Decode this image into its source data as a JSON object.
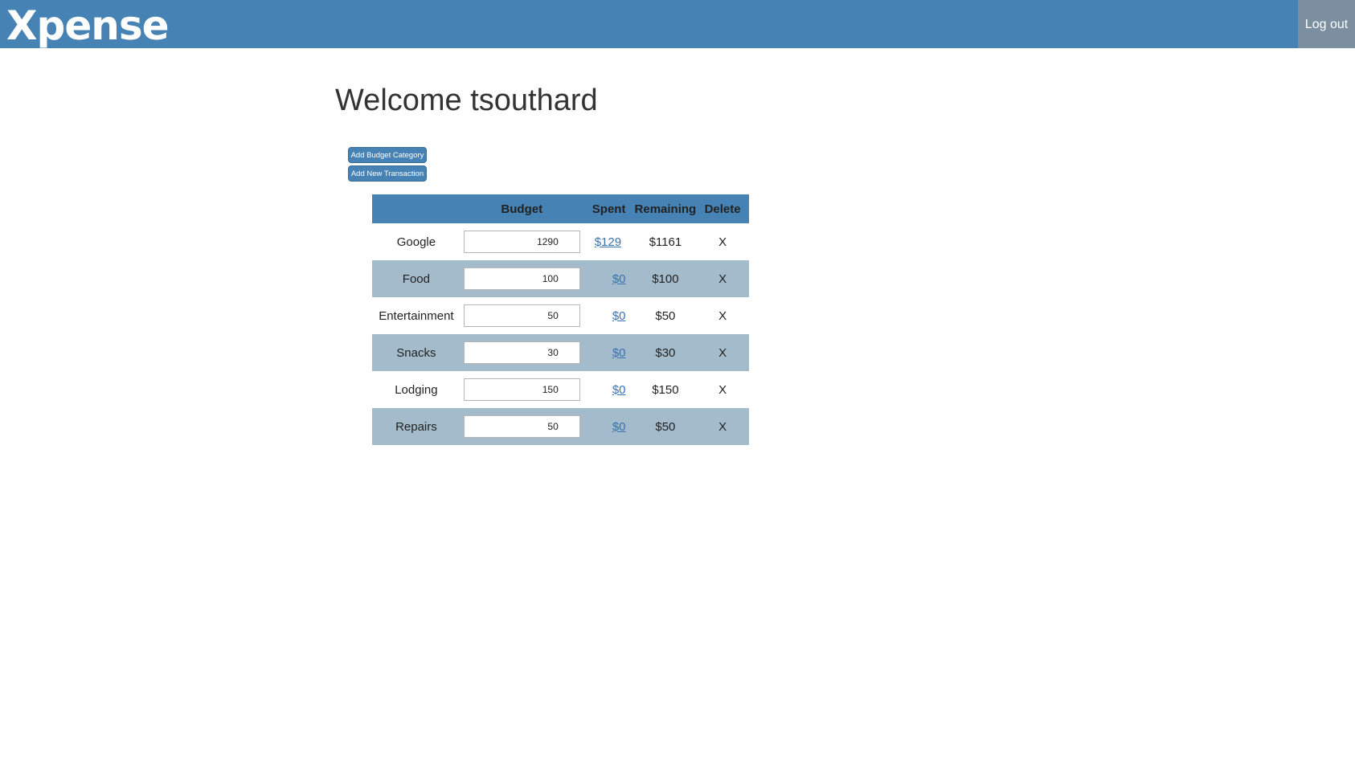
{
  "header": {
    "logo": "Xpense",
    "logout_label": "Log out"
  },
  "main": {
    "welcome": "Welcome tsouthard",
    "add_category_label": "Add Budget Category",
    "add_transaction_label": "Add New Transaction"
  },
  "table": {
    "headers": [
      "",
      "Budget",
      "Spent",
      "Remaining",
      "Delete"
    ],
    "rows": [
      {
        "name": "Google",
        "budget": "1290",
        "spent": "$129",
        "remaining": "$1161",
        "delete": "X"
      },
      {
        "name": "Food",
        "budget": "100",
        "spent": "$0",
        "remaining": "$100",
        "delete": "X"
      },
      {
        "name": "Entertainment",
        "budget": "50",
        "spent": "$0",
        "remaining": "$50",
        "delete": "X"
      },
      {
        "name": "Snacks",
        "budget": "30",
        "spent": "$0",
        "remaining": "$30",
        "delete": "X"
      },
      {
        "name": "Lodging",
        "budget": "150",
        "spent": "$0",
        "remaining": "$150",
        "delete": "X"
      },
      {
        "name": "Repairs",
        "budget": "50",
        "spent": "$0",
        "remaining": "$50",
        "delete": "X"
      }
    ]
  },
  "colors": {
    "header_bg": "#4682b4",
    "logout_bg": "#7b8fa1",
    "alt_row_bg": "#a3bbcb",
    "link": "#3a72b0"
  }
}
